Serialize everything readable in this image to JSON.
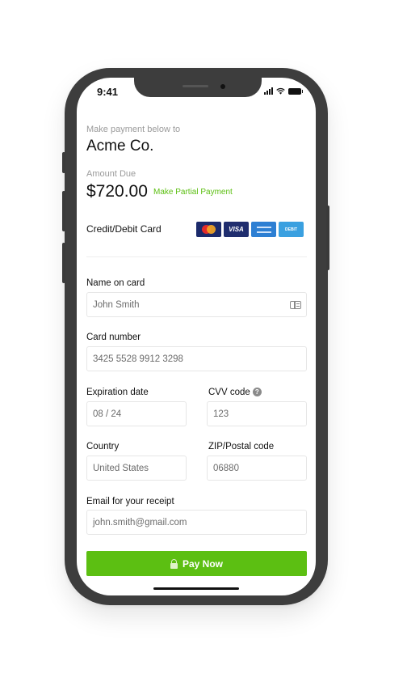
{
  "status_bar": {
    "time": "9:41"
  },
  "header": {
    "intro": "Make payment below to",
    "merchant": "Acme Co.",
    "amount_label": "Amount Due",
    "amount": "$720.00",
    "partial_link": "Make Partial Payment"
  },
  "payment_method": {
    "label": "Credit/Debit Card",
    "cards": [
      {
        "name": "mastercard",
        "label": ""
      },
      {
        "name": "visa",
        "label": "VISA"
      },
      {
        "name": "amex",
        "label": ""
      },
      {
        "name": "debit",
        "label": "DEBIT"
      }
    ]
  },
  "form": {
    "name": {
      "label": "Name on card",
      "value": "John Smith"
    },
    "card_number": {
      "label": "Card number",
      "value": "3425 5528 9912 3298"
    },
    "expiration": {
      "label": "Expiration date",
      "value": "08 / 24"
    },
    "cvv": {
      "label": "CVV code",
      "value": "123",
      "help": "?"
    },
    "country": {
      "label": "Country",
      "value": "United States"
    },
    "zip": {
      "label": "ZIP/Postal code",
      "value": "06880"
    },
    "email": {
      "label": "Email for your receipt",
      "value": "john.smith@gmail.com"
    }
  },
  "pay_button": {
    "label": "Pay Now"
  },
  "colors": {
    "accent": "#5cbf12",
    "phone_frame": "#3d3d3d"
  }
}
